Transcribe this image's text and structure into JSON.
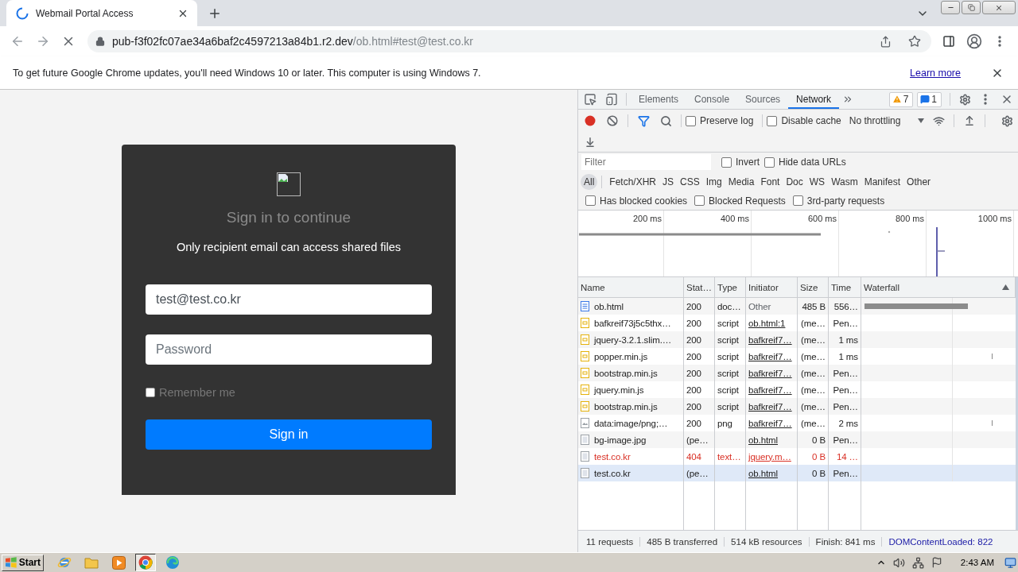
{
  "browser": {
    "loading": true,
    "tab": {
      "title": "Webmail Portal Access"
    },
    "address": {
      "host": "pub-f3f02fc07ae34a6baf2c4597213a84b1.r2.dev",
      "path": "/ob.html#test@test.co.kr"
    },
    "infobar": {
      "message": "To get future Google Chrome updates, you'll need Windows 10 or later. This computer is using Windows 7.",
      "link": "Learn more"
    }
  },
  "page": {
    "title": "Sign in to continue",
    "subtitle": "Only recipient email can access shared files",
    "email": {
      "value": "test@test.co.kr"
    },
    "password": {
      "placeholder": "Password"
    },
    "remember": {
      "label": "Remember me",
      "checked": false
    },
    "submit": "Sign in"
  },
  "devtools": {
    "tabs": [
      {
        "label": "Elements",
        "selected": false
      },
      {
        "label": "Console",
        "selected": false
      },
      {
        "label": "Sources",
        "selected": false
      },
      {
        "label": "Network",
        "selected": true
      }
    ],
    "warnings": "7",
    "messages": "1",
    "toolbar": {
      "recording": true,
      "options": [
        {
          "label": "Preserve log",
          "checked": false
        },
        {
          "label": "Disable cache",
          "checked": false
        }
      ],
      "throttling": "No throttling"
    },
    "filter": {
      "placeholder": "Filter",
      "options": [
        {
          "label": "Invert",
          "checked": false
        },
        {
          "label": "Hide data URLs",
          "checked": false
        }
      ]
    },
    "types": [
      {
        "label": "All",
        "selected": true
      },
      {
        "label": "Fetch/XHR",
        "selected": false
      },
      {
        "label": "JS",
        "selected": false
      },
      {
        "label": "CSS",
        "selected": false
      },
      {
        "label": "Img",
        "selected": false
      },
      {
        "label": "Media",
        "selected": false
      },
      {
        "label": "Font",
        "selected": false
      },
      {
        "label": "Doc",
        "selected": false
      },
      {
        "label": "WS",
        "selected": false
      },
      {
        "label": "Wasm",
        "selected": false
      },
      {
        "label": "Manifest",
        "selected": false
      },
      {
        "label": "Other",
        "selected": false
      }
    ],
    "extra_filters": [
      {
        "label": "Has blocked cookies",
        "checked": false
      },
      {
        "label": "Blocked Requests",
        "checked": false
      },
      {
        "label": "3rd-party requests",
        "checked": false
      }
    ],
    "overview": {
      "ticks": [
        "200 ms",
        "400 ms",
        "600 ms",
        "800 ms",
        "1000 ms"
      ]
    },
    "table": {
      "columns": [
        {
          "label": "Name",
          "sorted": false
        },
        {
          "label": "Stat…",
          "sorted": false
        },
        {
          "label": "Type",
          "sorted": false
        },
        {
          "label": "Initiator",
          "sorted": false
        },
        {
          "label": "Size",
          "sorted": false
        },
        {
          "label": "Time",
          "sorted": false
        },
        {
          "label": "Waterfall",
          "sorted": true
        }
      ],
      "rows": [
        {
          "name": "ob.html",
          "status": "200",
          "type": "doc…",
          "initiator": "Other",
          "initiator_link": false,
          "size": "485 B",
          "time": "556…",
          "kind": "document",
          "error": false,
          "selected": false,
          "waterfall": {
            "kind": "bar"
          }
        },
        {
          "name": "bafkreif73j5c5thx…",
          "status": "200",
          "type": "script",
          "initiator": "ob.html:1",
          "initiator_link": true,
          "size": "(me…",
          "time": "Pen…",
          "kind": "script",
          "error": false,
          "selected": false
        },
        {
          "name": "jquery-3.2.1.slim.…",
          "status": "200",
          "type": "script",
          "initiator": "bafkreif7…",
          "initiator_link": true,
          "size": "(me…",
          "time": "1 ms",
          "kind": "script",
          "error": false,
          "selected": false
        },
        {
          "name": "popper.min.js",
          "status": "200",
          "type": "script",
          "initiator": "bafkreif7…",
          "initiator_link": true,
          "size": "(me…",
          "time": "1 ms",
          "kind": "script",
          "error": false,
          "selected": false,
          "waterfall": {
            "kind": "tick"
          }
        },
        {
          "name": "bootstrap.min.js",
          "status": "200",
          "type": "script",
          "initiator": "bafkreif7…",
          "initiator_link": true,
          "size": "(me…",
          "time": "Pen…",
          "kind": "script",
          "error": false,
          "selected": false
        },
        {
          "name": "jquery.min.js",
          "status": "200",
          "type": "script",
          "initiator": "bafkreif7…",
          "initiator_link": true,
          "size": "(me…",
          "time": "Pen…",
          "kind": "script",
          "error": false,
          "selected": false
        },
        {
          "name": "bootstrap.min.js",
          "status": "200",
          "type": "script",
          "initiator": "bafkreif7…",
          "initiator_link": true,
          "size": "(me…",
          "time": "Pen…",
          "kind": "script",
          "error": false,
          "selected": false
        },
        {
          "name": "data:image/png;…",
          "status": "200",
          "type": "png",
          "initiator": "bafkreif7…",
          "initiator_link": true,
          "size": "(me…",
          "time": "2 ms",
          "kind": "image",
          "error": false,
          "selected": false,
          "waterfall": {
            "kind": "tick"
          }
        },
        {
          "name": "bg-image.jpg",
          "status": "(pe…",
          "initiator": "ob.html",
          "initiator_link": true,
          "size": "0 B",
          "time": "Pen…",
          "kind": "file",
          "error": false,
          "selected": false
        },
        {
          "name": "test.co.kr",
          "status": "404",
          "type": "text…",
          "initiator": "jquery.m…",
          "initiator_link": true,
          "size": "0 B",
          "time": "14 …",
          "kind": "file",
          "error": true,
          "selected": false
        },
        {
          "name": "test.co.kr",
          "status": "(pe…",
          "initiator": "ob.html",
          "initiator_link": true,
          "size": "0 B",
          "time": "Pen…",
          "kind": "file",
          "error": false,
          "selected": true
        }
      ]
    },
    "summary": [
      {
        "text": "11 requests",
        "kind": "plain"
      },
      {
        "text": "485 B transferred",
        "kind": "plain"
      },
      {
        "text": "514 kB resources",
        "kind": "plain"
      },
      {
        "text": "Finish: 841 ms",
        "kind": "plain"
      },
      {
        "text": "DOMContentLoaded: 822",
        "kind": "domcontentloaded"
      }
    ]
  },
  "taskbar": {
    "start": "Start",
    "apps": [
      {
        "kind": "orbit",
        "active": false
      },
      {
        "kind": "folder",
        "active": false
      },
      {
        "kind": "player",
        "active": false
      },
      {
        "kind": "wheel",
        "active": true
      },
      {
        "kind": "swirl",
        "active": false
      }
    ],
    "clock": "2:43 AM"
  }
}
